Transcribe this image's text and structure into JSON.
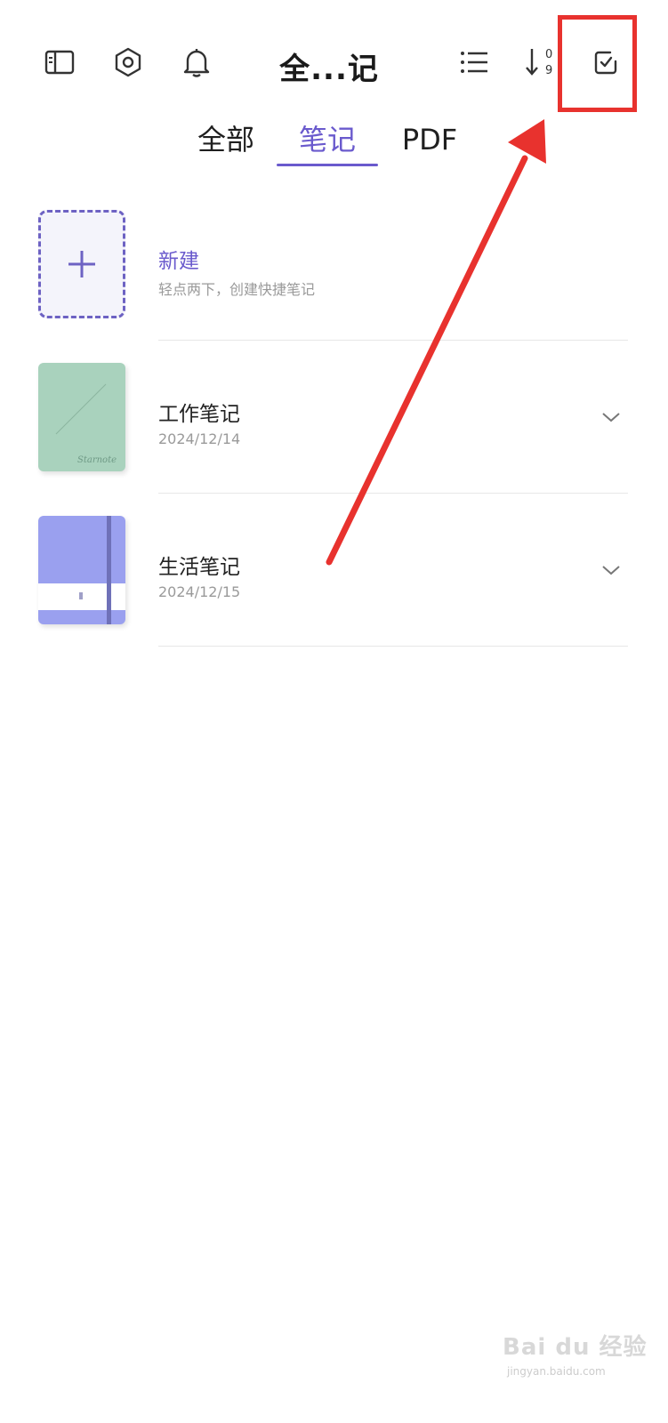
{
  "header": {
    "title": "全...记",
    "icons": {
      "sidebar": "sidebar-icon",
      "settings": "hexagon-settings-icon",
      "notifications": "bell-icon",
      "view_list": "list-view-icon",
      "sort": "sort-numeric-icon",
      "select": "checkbox-select-icon"
    },
    "sort_digits": {
      "top": "0",
      "bottom": "9"
    }
  },
  "tabs": [
    {
      "label": "全部",
      "active": false
    },
    {
      "label": "笔记",
      "active": true
    },
    {
      "label": "PDF",
      "active": false
    }
  ],
  "new_item": {
    "title": "新建",
    "subtitle": "轻点两下，创建快捷笔记",
    "icon": "plus-icon"
  },
  "notebooks": [
    {
      "title": "工作笔记",
      "date": "2024/12/14",
      "cover_color": "#a9d2bd",
      "cover_text": "Starnote"
    },
    {
      "title": "生活笔记",
      "date": "2024/12/15",
      "cover_color": "#9aa0ef"
    }
  ],
  "colors": {
    "accent": "#6a5acd",
    "annotation_red": "#e8322e"
  },
  "watermark": {
    "text": "Bai du 经验",
    "sub": "jingyan.baidu.com"
  }
}
